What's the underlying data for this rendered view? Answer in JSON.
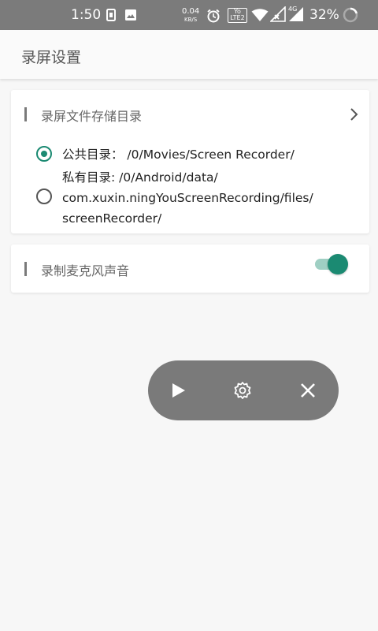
{
  "status_bar": {
    "time": "1:50",
    "net_speed_value": "0.04",
    "net_speed_unit": "KB/S",
    "volte_label_top": "Yo",
    "volte_label_bottom": "LTE2",
    "signal_type": "4G",
    "battery": "32%",
    "icons": [
      "sim-icon",
      "image-icon",
      "alarm-icon",
      "wifi-icon",
      "signal-icon",
      "battery-icon"
    ]
  },
  "app_bar": {
    "title": "录屏设置"
  },
  "storage_section": {
    "title": "录屏文件存储目录",
    "options": [
      {
        "lines": [
          "公共目录：  /0/Movies/Screen Recorder/"
        ],
        "selected": true
      },
      {
        "lines": [
          "私有目录: /0/Android/data/",
          "com.xuxin.ningYouScreenRecording/files/",
          "screenRecorder/"
        ],
        "selected": false
      }
    ]
  },
  "mic_section": {
    "title": "录制麦克风声音",
    "toggle_on": true
  },
  "floating_controls": {
    "buttons": [
      "play-icon",
      "gear-icon",
      "close-icon"
    ]
  },
  "colors": {
    "accent": "#1b8a72",
    "status_bar": "#7b7b7b",
    "floating_bg": "#7a7a7a"
  }
}
